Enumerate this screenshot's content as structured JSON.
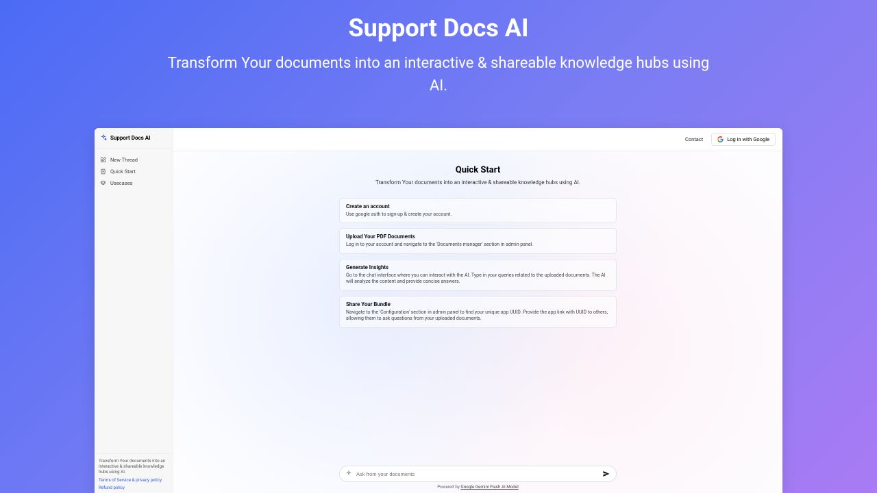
{
  "hero": {
    "title": "Support Docs AI",
    "subtitle": "Transform Your documents into an interactive & shareable knowledge hubs using AI."
  },
  "sidebar": {
    "brand": "Support Docs AI",
    "items": [
      {
        "label": "New Thread"
      },
      {
        "label": "Quick Start"
      },
      {
        "label": "Usecases"
      }
    ],
    "footer": {
      "blurb": "Transform Your documents into an interactive & shareable knowledge hubs using AI.",
      "terms": "Terms of Service & privacy policy",
      "refund": "Refund policy"
    }
  },
  "topbar": {
    "contact": "Contact",
    "login": "Log in with Google"
  },
  "page": {
    "title": "Quick Start",
    "subtitle": "Transform Your documents into an interactive & shareable knowledge hubs using AI."
  },
  "cards": [
    {
      "title": "Create an account",
      "body": "Use google auth to sign-up & create your account."
    },
    {
      "title": "Upload Your PDF Documents",
      "body": "Log in to your account and navigate to the 'Documents manager' section in admin panel."
    },
    {
      "title": "Generate Insights",
      "body": "Go to the chat interface where you can interact with the AI. Type in your queries related to the uploaded documents. The AI will analyze the content and provide concise answers."
    },
    {
      "title": "Share Your Bundle",
      "body": "Navigate to the 'Configuration' section in admin panel to find your unique app UUID. Provide the app link with UUID to others, allowing them to ask questions from your uploaded documents."
    }
  ],
  "input": {
    "placeholder": "Ask from your documents"
  },
  "powered": {
    "prefix": "Powered by ",
    "model": "Google Gemini Flash AI Model"
  }
}
